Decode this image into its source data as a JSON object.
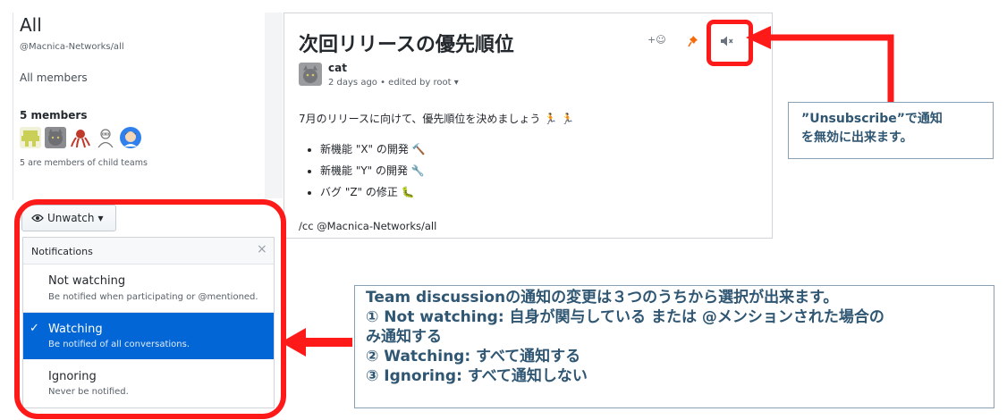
{
  "team": {
    "name": "All",
    "slug": "@Macnica-Networks/all",
    "all_members_label": "All members",
    "members_count_label": "5 members",
    "child_teams_note": "5 are members of child teams",
    "avatars": [
      "pixel-avatar",
      "cat-avatar",
      "octopus-avatar",
      "sketch-avatar",
      "person-avatar"
    ]
  },
  "discussion": {
    "title": "次回リリースの優先順位",
    "reaction_label": "+☺",
    "author": "cat",
    "meta": "2 days ago • edited by root ▾",
    "intro": "7月のリリースに向けて、優先順位を決めましょう 🏃 🏃",
    "items": [
      "新機能 \"X\" の開発 🔨",
      "新機能 \"Y\" の開発 🔧",
      "バグ \"Z\" の修正 🐛"
    ],
    "cc": "/cc @Macnica-Networks/all"
  },
  "watch": {
    "button_label": "Unwatch",
    "button_caret": "▾",
    "dropdown_header": "Notifications",
    "close_glyph": "×",
    "options": [
      {
        "title": "Not watching",
        "desc": "Be notified when participating or @mentioned.",
        "selected": false
      },
      {
        "title": "Watching",
        "desc": "Be notified of all conversations.",
        "selected": true
      },
      {
        "title": "Ignoring",
        "desc": "Never be notified.",
        "selected": false
      }
    ],
    "check_glyph": "✓"
  },
  "callouts": {
    "unsubscribe": [
      "”Unsubscribe”で通知",
      "を無効に出来ます。"
    ],
    "team_discussion": [
      "Team discussionの通知の変更は３つのうちから選択が出来ます。",
      "① Not watching: 自身が関与している または @メンションされた場合の",
      "み通知する",
      "② Watching: すべて通知する",
      "③ Ignoring: すべて通知しない"
    ]
  },
  "colors": {
    "highlight": "#ff1a1a",
    "callout_text": "#2f5672",
    "selected_bg": "#0366d6",
    "pin": "#f66a0a"
  }
}
